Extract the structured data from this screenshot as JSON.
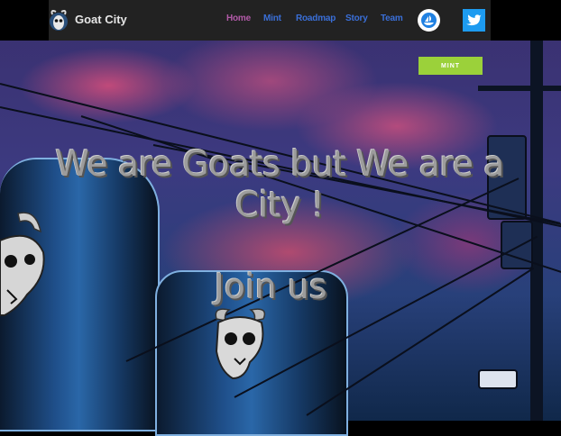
{
  "site": {
    "title": "Goat City",
    "logo_icon": "goat-logo-icon"
  },
  "nav": {
    "items": [
      {
        "label": "Home",
        "active": true
      },
      {
        "label": "Mint",
        "active": false
      },
      {
        "label": "Roadmap",
        "active": false
      },
      {
        "label": "Story",
        "active": false
      },
      {
        "label": "Team",
        "active": false
      }
    ],
    "opensea_icon": "opensea-icon",
    "twitter_icon": "twitter-icon"
  },
  "mint_button": {
    "label": "MINT"
  },
  "hero": {
    "headline": "We are Goats but We are a City !",
    "subheadline": "Join us"
  },
  "colors": {
    "header_bg": "#222222",
    "nav_link": "#3a6fd8",
    "nav_active": "#b25aa8",
    "mint_button": "#9bd13a",
    "twitter_blue": "#1d9bf0"
  }
}
